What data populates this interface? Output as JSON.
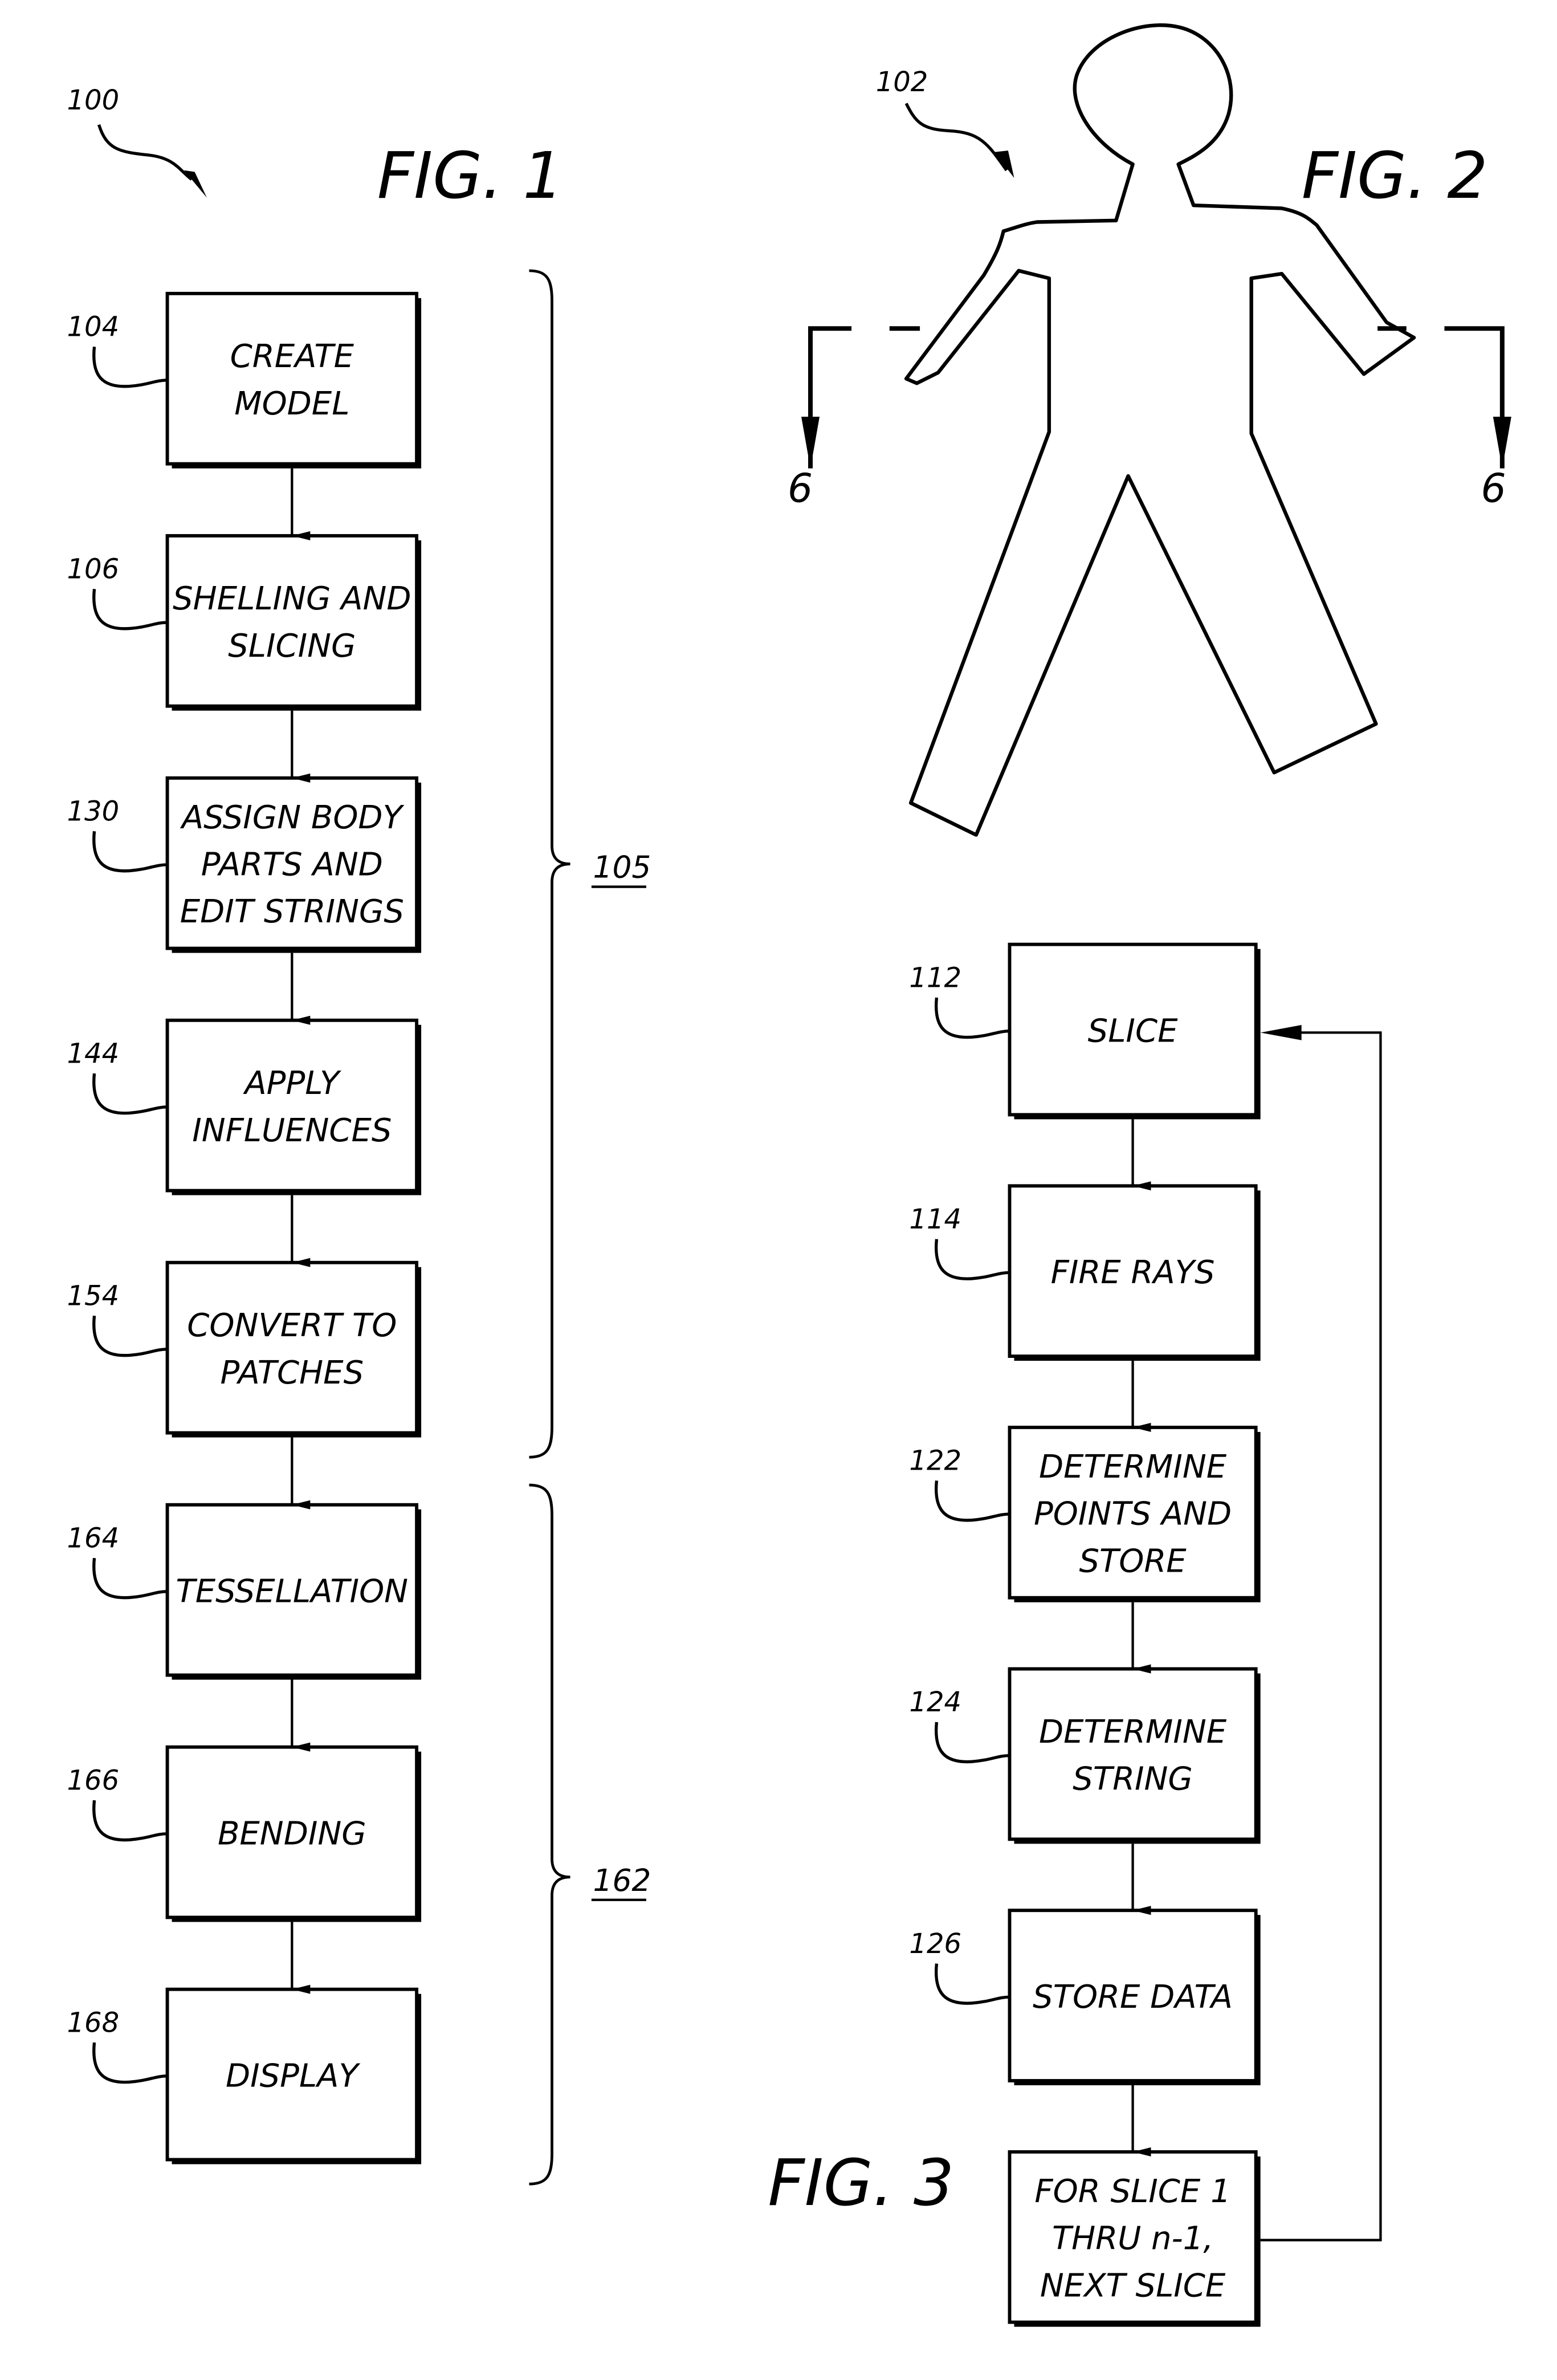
{
  "fig1": {
    "title": "FIG. 1",
    "ref": "100",
    "steps": [
      {
        "ref": "104",
        "lines": [
          "CREATE",
          "MODEL"
        ]
      },
      {
        "ref": "106",
        "lines": [
          "SHELLING AND",
          "SLICING"
        ]
      },
      {
        "ref": "130",
        "lines": [
          "ASSIGN BODY",
          "PARTS AND",
          "EDIT STRINGS"
        ]
      },
      {
        "ref": "144",
        "lines": [
          "APPLY",
          "INFLUENCES"
        ]
      },
      {
        "ref": "154",
        "lines": [
          "CONVERT TO",
          "PATCHES"
        ]
      },
      {
        "ref": "164",
        "lines": [
          "TESSELLATION"
        ]
      },
      {
        "ref": "166",
        "lines": [
          "BENDING"
        ]
      },
      {
        "ref": "168",
        "lines": [
          "DISPLAY"
        ]
      }
    ],
    "groups": [
      {
        "ref": "105",
        "from_step": 0,
        "to_step": 4
      },
      {
        "ref": "162",
        "from_step": 5,
        "to_step": 7
      }
    ]
  },
  "fig2": {
    "title": "FIG. 2",
    "ref": "102",
    "section_marks": [
      "6",
      "6"
    ]
  },
  "fig3": {
    "title": "FIG. 3",
    "steps": [
      {
        "ref": "112",
        "lines": [
          "SLICE"
        ]
      },
      {
        "ref": "114",
        "lines": [
          "FIRE RAYS"
        ]
      },
      {
        "ref": "122",
        "lines": [
          "DETERMINE",
          "POINTS AND",
          "STORE"
        ]
      },
      {
        "ref": "124",
        "lines": [
          "DETERMINE",
          "STRING"
        ]
      },
      {
        "ref": "126",
        "lines": [
          "STORE DATA"
        ]
      },
      {
        "ref": "",
        "lines": [
          "FOR SLICE 1",
          "THRU n-1,",
          "NEXT SLICE"
        ]
      }
    ],
    "loop": {
      "from_step": 5,
      "to_step": 0
    }
  }
}
